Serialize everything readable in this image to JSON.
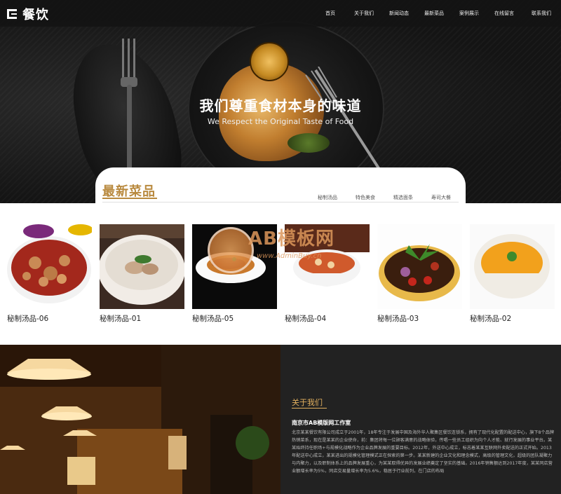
{
  "header": {
    "logo_text": "餐饮",
    "nav": [
      "首页",
      "关于我们",
      "新闻动态",
      "最新菜品",
      "案例展示",
      "在线留言",
      "联系我们"
    ]
  },
  "hero": {
    "title": "我们尊重食材本身的味道",
    "subtitle": "We Respect the Original Taste of Food"
  },
  "menu": {
    "title": "最新菜品",
    "tabs": [
      "秘制汤品",
      "特色美食",
      "精选面条",
      "寿司大餐"
    ],
    "dishes": [
      {
        "name": "秘制汤品-06"
      },
      {
        "name": "秘制汤品-01"
      },
      {
        "name": "秘制汤品-05"
      },
      {
        "name": "秘制汤品-04"
      },
      {
        "name": "秘制汤品-03"
      },
      {
        "name": "秘制汤品-02"
      }
    ]
  },
  "watermark": {
    "text": "AB模板网",
    "url": "www.AdminBuy.cn"
  },
  "about": {
    "title": "关于我们",
    "company": "南京市AB模版网工作室",
    "body": "北京某某餐饮有限公司成立于2001年，18年专注于发展中国及海外华人聚集区餐饮连锁系，拥有了现代化配置的配送中心，旗下8个品牌热销菜系，现在是某某的企业使命，前：集团将每一位顾客满意的战略体验，传唱一些员工组织为向个人才能、就行发展的事业平台。某某始终持任职场+与规模化战略作为企业品牌发展的重要目标。2012年，外送中心成立，标志着某某互联网外卖配送的正式开始。2013年配送中心成立，某某进出的规模化管理模式正在探索的第一步。某某新建的企业文化和理念模式，高级的管理文化，超级的团队凝聚力与内聚力，以及职制体系上的品牌发展重心，为某某取得优异的发展业绩奠定了坚实的基础。2016年销售额达到2017年度，某某同店营业额增长率为5%，同店交易量增长率为5.6%，稳居于行业前列，在门店的布局"
  }
}
